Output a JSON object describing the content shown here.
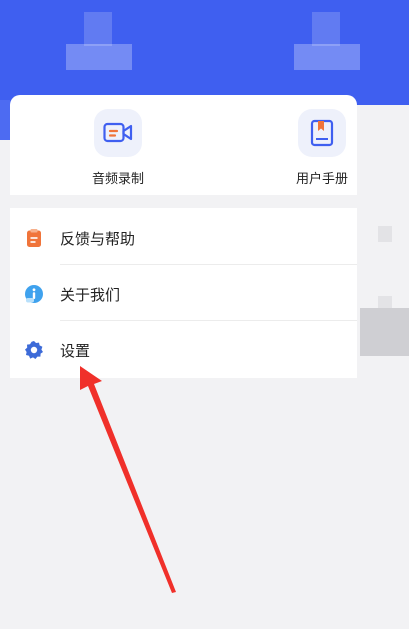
{
  "quick_actions": [
    {
      "label": "音频录制",
      "icon": "video-record-icon"
    },
    {
      "label": "用户手册",
      "icon": "manual-book-icon"
    }
  ],
  "menu": [
    {
      "label": "反馈与帮助",
      "icon": "clipboard-icon"
    },
    {
      "label": "关于我们",
      "icon": "info-icon"
    },
    {
      "label": "设置",
      "icon": "gear-icon"
    }
  ],
  "colors": {
    "header": "#3f5ff0",
    "accent_orange": "#f0743a",
    "info_blue": "#3fa2ee",
    "gear_blue": "#3d6bd8",
    "annotation_red": "#f0302a"
  }
}
